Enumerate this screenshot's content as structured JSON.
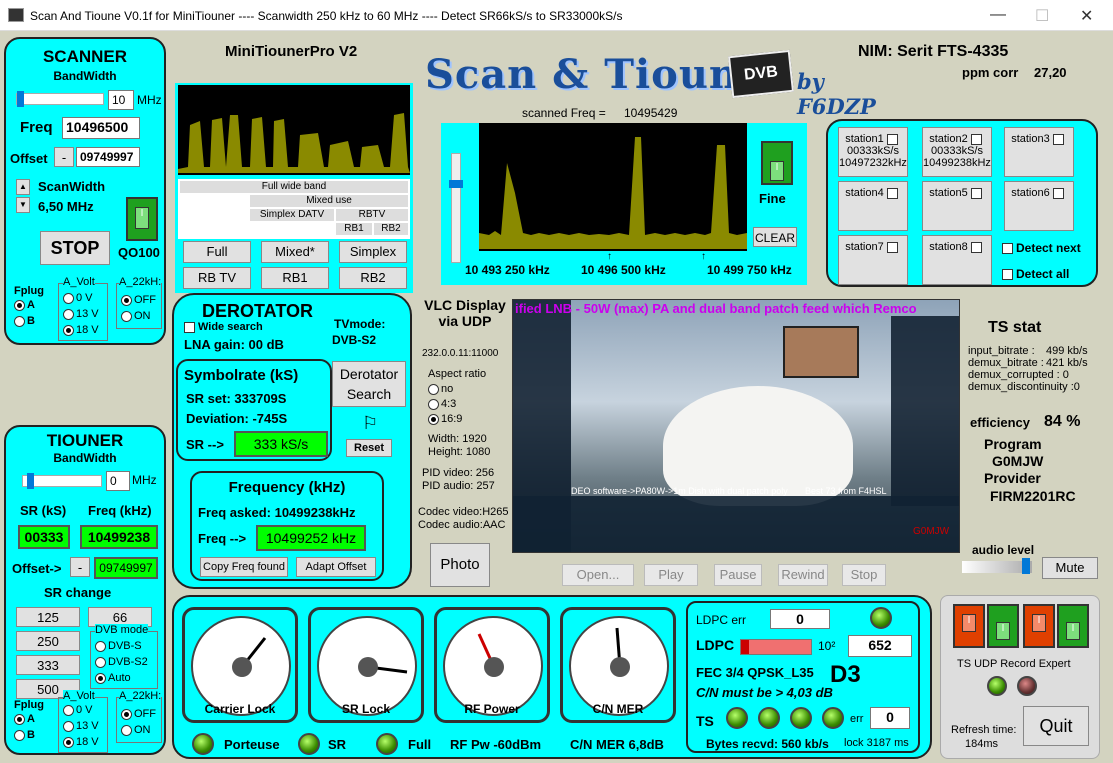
{
  "window": {
    "title": "Scan And Tioune V0.1f for MiniTiouner ---- Scanwidth 250 kHz to 60 MHz ---- Detect SR66kS/s to SR33000kS/s"
  },
  "scanner": {
    "title": "SCANNER",
    "bandwidth_label": "BandWidth",
    "bandwidth_value": "10",
    "bandwidth_unit": "MHz",
    "freq_label": "Freq",
    "freq_value": "10496500",
    "offset_label": "Offset",
    "offset_sign": "-",
    "offset_value": "09749997",
    "scanwidth_label": "ScanWidth",
    "scanwidth_value": "6,50 MHz",
    "stop_label": "STOP",
    "qo100_label": "QO100",
    "fplug_label": "Fplug",
    "fplug_a": "A",
    "fplug_b": "B",
    "avolt_label": "A_Volt",
    "v0": "0 V",
    "v13": "13 V",
    "v18": "18 V",
    "a22_label": "A_22kH:",
    "off": "OFF",
    "on": "ON"
  },
  "header": {
    "device": "MiniTiounerPro V2",
    "nim": "NIM: Serit FTS-4335",
    "ppm_label": "ppm corr",
    "ppm_value": "27,20",
    "logo": "Scan & Tioune",
    "logo_dvb": "DVB",
    "logo_by": "by F6DZP"
  },
  "mini_spectrum": {
    "rows": [
      "Full wide band",
      "Mixed use",
      "Simplex DATV",
      "RBTV",
      "RB1",
      "RB2"
    ],
    "buttons": [
      "Full",
      "Mixed*",
      "Simplex",
      "RB TV",
      "RB1",
      "RB2"
    ]
  },
  "spectrum": {
    "scanned_label": "scanned Freq =",
    "scanned_value": "10495429",
    "x_left": "10 493 250 kHz",
    "x_mid": "10 496 500 kHz",
    "x_right": "10 499 750 kHz",
    "fine_label": "Fine",
    "clear_label": "CLEAR"
  },
  "stations": [
    {
      "name": "station1",
      "l1": "00333kS/s",
      "l2": "10497232kHz"
    },
    {
      "name": "station2",
      "l1": "00333kS/s",
      "l2": "10499238kHz"
    },
    {
      "name": "station3",
      "l1": "",
      "l2": ""
    },
    {
      "name": "station4",
      "l1": "",
      "l2": ""
    },
    {
      "name": "station5",
      "l1": "",
      "l2": ""
    },
    {
      "name": "station6",
      "l1": "",
      "l2": ""
    },
    {
      "name": "station7",
      "l1": "",
      "l2": ""
    },
    {
      "name": "station8",
      "l1": "",
      "l2": ""
    }
  ],
  "detect": {
    "next": "Detect next",
    "all": "Detect all"
  },
  "derotator": {
    "title": "DEROTATOR",
    "wide_search": "Wide search",
    "tvmode_label": "TVmode:",
    "tvmode_value": "DVB-S2",
    "lna": "LNA gain: 00 dB",
    "sr_title": "Symbolrate (kS)",
    "sr_set": "SR set: 333709S",
    "deviation": "Deviation: -745S",
    "sr_arrow": "SR -->",
    "sr_value": "333 kS/s",
    "search_btn": "Derotator Search",
    "reset_btn": "Reset",
    "freq_title": "Frequency (kHz)",
    "freq_asked": "Freq asked: 10499238kHz",
    "freq_arrow": "Freq -->",
    "freq_value": "10499252 kHz",
    "copy_btn": "Copy Freq found",
    "adapt_btn": "Adapt Offset"
  },
  "vlc": {
    "title": "VLC Display via UDP",
    "ip": "232.0.0.11:11000",
    "aspect_label": "Aspect ratio",
    "a_no": "no",
    "a_43": "4:3",
    "a_169": "16:9",
    "width": "Width:  1920",
    "height": "Height:  1080",
    "pid_video": "PID video:  256",
    "pid_audio": "PID audio:  257",
    "codec_video": "Codec video:H265",
    "codec_audio": "Codec audio:AAC",
    "photo": "Photo",
    "open": "Open...",
    "play": "Play",
    "pause": "Pause",
    "rewind": "Rewind",
    "stop": "Stop",
    "banner": "ified LNB - 50W (max) PA and dual band patch feed which Remco",
    "bottom_text": "DEO software->PA80W->1m Dish with dual patch poly",
    "best": "Best 73 from F4HSL",
    "callsign": "G0MJW"
  },
  "ts": {
    "title": "TS stat",
    "input_label": "input_bitrate :",
    "input_value": "499 kb/s",
    "demux_label": "demux_bitrate :",
    "demux_value": "421 kb/s",
    "corrupted": "demux_corrupted : 0",
    "discontinuity": "demux_discontinuity :0",
    "eff_label": "efficiency",
    "eff_value": "84 %",
    "program_label": "Program",
    "program_value": "G0MJW",
    "provider_label": "Provider",
    "provider_value": "FIRM2201RC",
    "audio_label": "audio level",
    "mute": "Mute"
  },
  "tiouner": {
    "title": "TIOUNER",
    "bandwidth_label": "BandWidth",
    "bandwidth_value": "0",
    "unit": "MHz",
    "sr_label": "SR (kS)",
    "freq_label": "Freq (kHz)",
    "sr_value": "00333",
    "freq_value": "10499238",
    "offset_label": "Offset->",
    "offset_sign": "-",
    "offset_value": "09749997",
    "src_label": "SR change",
    "sr_btns": [
      "125",
      "66",
      "250",
      "333",
      "500"
    ],
    "dvb_label": "DVB mode",
    "dvbs": "DVB-S",
    "dvbs2": "DVB-S2",
    "auto": "Auto",
    "fplug_label": "Fplug",
    "a": "A",
    "b": "B",
    "avolt_label": "A_Volt",
    "v0": "0 V",
    "v13": "13 V",
    "v18": "18 V",
    "a22_label": "A_22kH:",
    "off": "OFF",
    "on": "ON"
  },
  "gauges": [
    {
      "name": "Carrier Lock",
      "value": 85
    },
    {
      "name": "SR Lock",
      "value": 100
    },
    {
      "name": "RF Power",
      "value": -60
    },
    {
      "name": "C/N MER",
      "value": 6.8
    }
  ],
  "status": {
    "porteuse": "Porteuse",
    "sr": "SR",
    "full": "Full",
    "rfpw": "RF Pw -60dBm",
    "cnmer": "C/N MER 6,8dB"
  },
  "ldpc": {
    "err_label": "LDPC err",
    "err_value": "0",
    "ldpc_label": "LDPC",
    "ldpc_exp": "10²",
    "ldpc_value": "652",
    "fec": "FEC  3/4 QPSK_L35",
    "mode": "D3",
    "cn_must": "C/N  must  be  > 4,03 dB",
    "ts_label": "TS",
    "err2": "err",
    "err2_value": "0",
    "bytes": "Bytes recvd:   560 kb/s",
    "lock": "lock  3187 ms"
  },
  "right": {
    "ts_udp": "TS UDP Record Expert",
    "refresh_label": "Refresh time:",
    "refresh_value": "184ms",
    "quit": "Quit"
  }
}
